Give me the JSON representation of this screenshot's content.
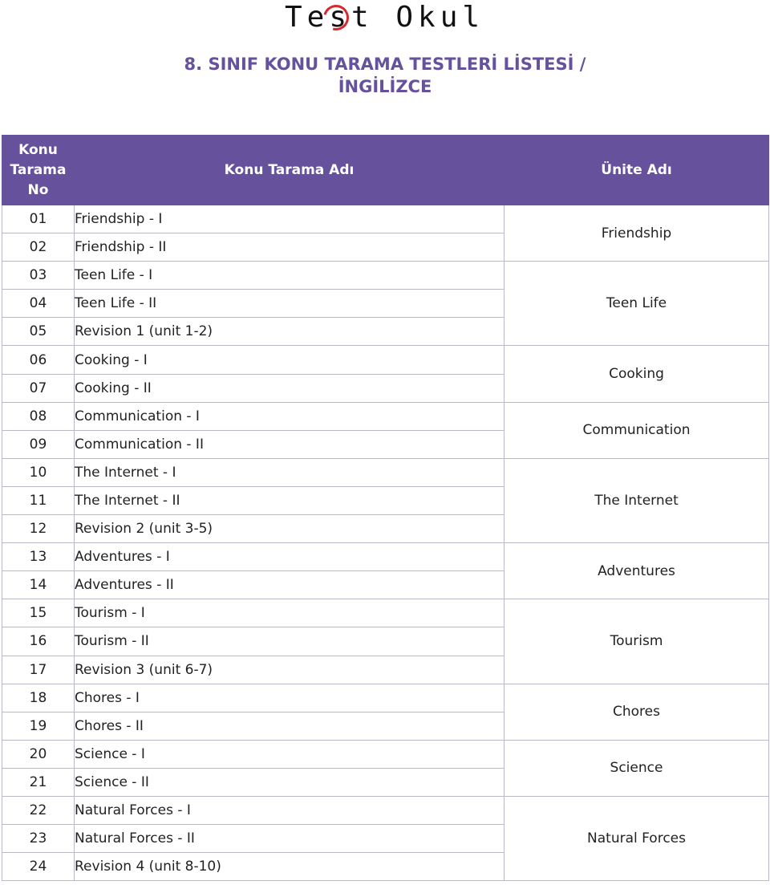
{
  "logo": {
    "text": "Test Okul",
    "icon": "circled-e-logo-icon"
  },
  "title": {
    "line1": "8. SINIF  KONU TARAMA TESTLERİ LİSTESİ /",
    "line2": "İNGİLİZCE"
  },
  "colors": {
    "accent": "#66519c",
    "header_text": "#ffffff",
    "logo_ring": "#d7282f",
    "border": "#b9b9c9"
  },
  "table": {
    "headers": {
      "no": "Konu Tarama No",
      "name": "Konu Tarama Adı",
      "unit": "Ünite Adı"
    },
    "rows": [
      {
        "no": "01",
        "name": "Friendship - I"
      },
      {
        "no": "02",
        "name": "Friendship - II"
      },
      {
        "no": "03",
        "name": "Teen Life - I"
      },
      {
        "no": "04",
        "name": "Teen Life - II"
      },
      {
        "no": "05",
        "name": "Revision 1 (unit 1-2)"
      },
      {
        "no": "06",
        "name": "Cooking - I"
      },
      {
        "no": "07",
        "name": "Cooking - II"
      },
      {
        "no": "08",
        "name": "Communication - I"
      },
      {
        "no": "09",
        "name": "Communication - II"
      },
      {
        "no": "10",
        "name": "The Internet - I"
      },
      {
        "no": "11",
        "name": "The Internet - II"
      },
      {
        "no": "12",
        "name": "Revision 2 (unit 3-5)"
      },
      {
        "no": "13",
        "name": "Adventures - I"
      },
      {
        "no": "14",
        "name": "Adventures - II"
      },
      {
        "no": "15",
        "name": "Tourism - I"
      },
      {
        "no": "16",
        "name": "Tourism - II"
      },
      {
        "no": "17",
        "name": "Revision 3 (unit 6-7)"
      },
      {
        "no": "18",
        "name": "Chores - I"
      },
      {
        "no": "19",
        "name": "Chores - II"
      },
      {
        "no": "20",
        "name": "Science - I"
      },
      {
        "no": "21",
        "name": "Science - II"
      },
      {
        "no": "22",
        "name": "Natural Forces - I"
      },
      {
        "no": "23",
        "name": "Natural Forces - II"
      },
      {
        "no": "24",
        "name": "Revision 4 (unit 8-10)"
      }
    ],
    "units": [
      {
        "label": "Friendship",
        "rows": 2
      },
      {
        "label": "Teen Life",
        "rows": 3
      },
      {
        "label": "Cooking",
        "rows": 2
      },
      {
        "label": "Communication",
        "rows": 2
      },
      {
        "label": "The Internet",
        "rows": 3
      },
      {
        "label": "Adventures",
        "rows": 2
      },
      {
        "label": "Tourism",
        "rows": 3
      },
      {
        "label": "Chores",
        "rows": 2
      },
      {
        "label": "Science",
        "rows": 2
      },
      {
        "label": "Natural Forces",
        "rows": 3
      }
    ]
  }
}
